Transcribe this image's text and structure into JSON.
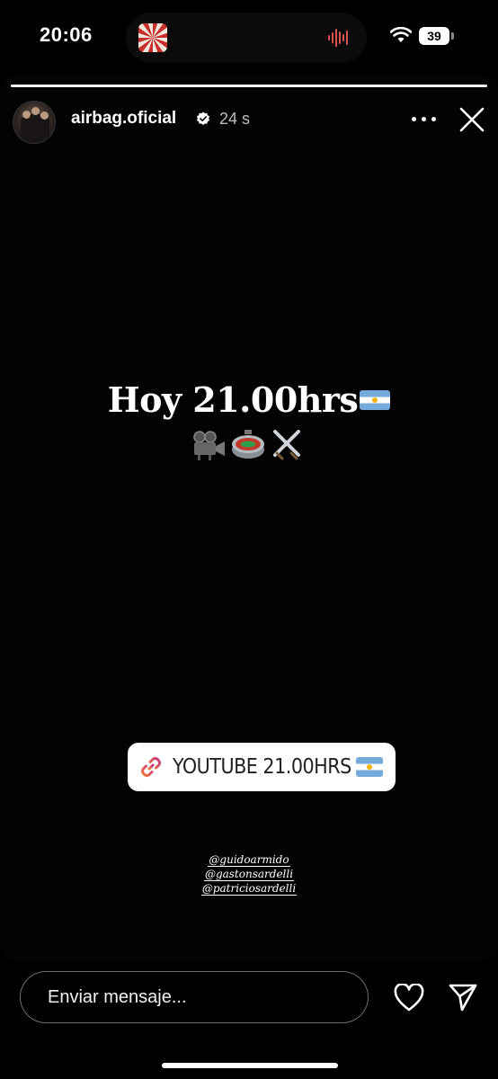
{
  "status_bar": {
    "time": "20:06",
    "battery_level": "39",
    "icons": [
      "wifi-icon",
      "battery-icon",
      "audio-waveform-icon"
    ]
  },
  "story": {
    "progress": 1.0,
    "username": "airbag.oficial",
    "verified": true,
    "time_ago": "24 s",
    "headline": "Hoy 21.00hrs",
    "headline_emoji": [
      "argentina-flag",
      "movie-camera",
      "stadium",
      "crossed-swords"
    ],
    "link_sticker": {
      "label": "YOUTUBE 21.00HRS",
      "icon": "link-icon"
    },
    "mentions": [
      "@guidoarmido",
      "@gastonsardelli",
      "@patriciosardelli"
    ]
  },
  "bottom_bar": {
    "message_placeholder": "Enviar mensaje...",
    "icons": [
      "heart-icon",
      "send-icon"
    ]
  },
  "colors": {
    "background": "#000000",
    "link_gradient_start": "#f77737",
    "link_gradient_end": "#c13584",
    "verified_badge": "#ffffff"
  }
}
